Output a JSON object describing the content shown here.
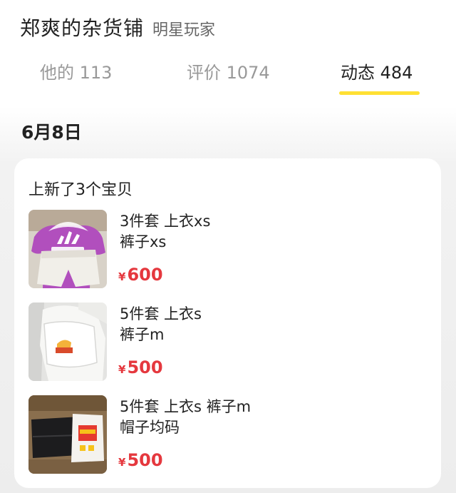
{
  "header": {
    "shop_name": "郑爽的杂货铺",
    "shop_tag": "明星玩家"
  },
  "tabs": [
    {
      "label": "他的 113",
      "active": false
    },
    {
      "label": "评价 1074",
      "active": false
    },
    {
      "label": "动态 484",
      "active": true
    }
  ],
  "colors": {
    "accent": "#ffe033",
    "price": "#e5383e"
  },
  "feed": {
    "date": "6月8日",
    "card_title": "上新了3个宝贝",
    "items": [
      {
        "desc": "3件套 上衣xs\n裤子xs",
        "currency": "¥",
        "price": "600",
        "thumb": "adidas-purple-top-white-shorts"
      },
      {
        "desc": "5件套 上衣s\n裤子m",
        "currency": "¥",
        "price": "500",
        "thumb": "white-outfit-cap"
      },
      {
        "desc": "5件套 上衣s 裤子m\n帽子均码",
        "currency": "¥",
        "price": "500",
        "thumb": "black-pants-white-tee"
      }
    ]
  }
}
